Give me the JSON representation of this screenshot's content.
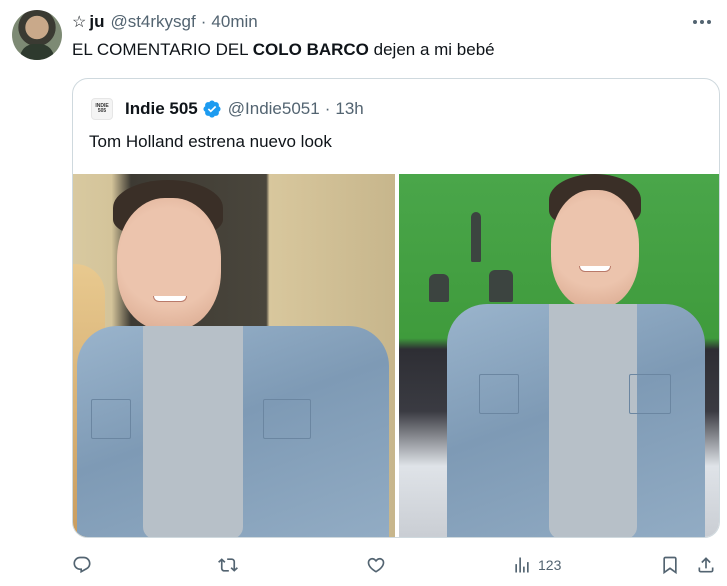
{
  "tweet": {
    "author_prefix": "☆",
    "author_name": "ju",
    "handle": "@st4rkysgf",
    "time": "40min",
    "text_before": "EL COMENTARIO DEL ",
    "text_bold": "COLO BARCO",
    "text_after": " dejen a mi bebé"
  },
  "quote": {
    "logo_line1": "INDIE",
    "logo_line2": "505",
    "name": "Indie 505",
    "verified": true,
    "handle": "@Indie5051",
    "time": "13h",
    "text": "Tom Holland estrena nuevo look"
  },
  "actions": {
    "reply_icon": "reply-icon",
    "retweet_icon": "retweet-icon",
    "like_icon": "like-icon",
    "views_icon": "views-icon",
    "views_count": "123",
    "bookmark_icon": "bookmark-icon",
    "share_icon": "share-icon"
  },
  "colors": {
    "text": "#0f1419",
    "secondary": "#536471",
    "border": "#cfd9de",
    "verified": "#1d9bf0"
  }
}
